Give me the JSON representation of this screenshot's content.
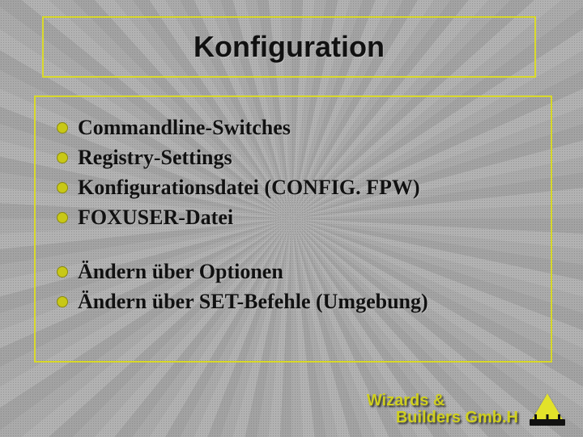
{
  "title": "Konfiguration",
  "bullets_group1": [
    "Commandline-Switches",
    "Registry-Settings",
    "Konfigurationsdatei (CONFIG. FPW)",
    "FOXUSER-Datei"
  ],
  "bullets_group2": [
    "Ändern über Optionen",
    "Ändern über SET-Befehle (Umgebung)"
  ],
  "footer": {
    "line1": "Wizards &",
    "line2": "Builders Gmb.H"
  },
  "colors": {
    "accent": "#d8d82a",
    "bullet": "#c8c817",
    "background": "#9e9e9e"
  }
}
